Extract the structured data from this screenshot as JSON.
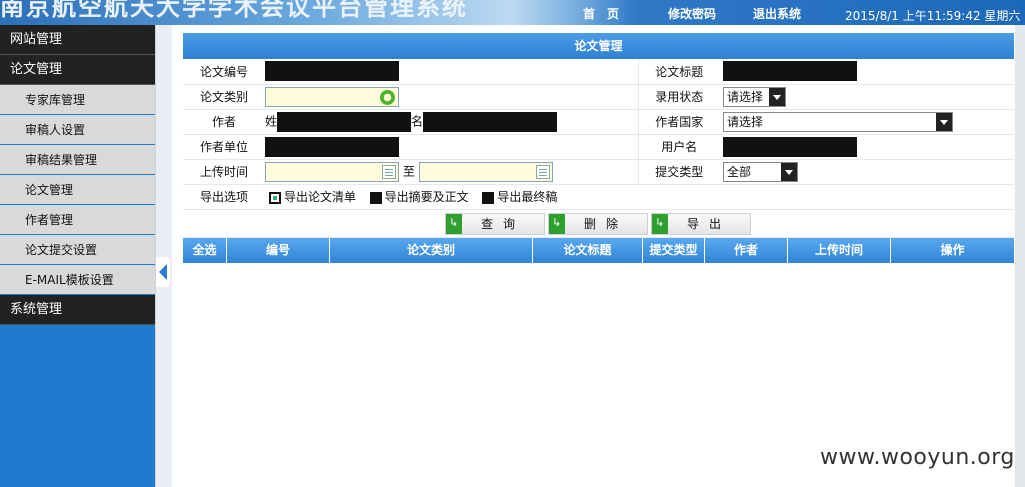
{
  "header": {
    "title": "南京航空航天大学学术会议平台管理系统",
    "nav": [
      "首　页",
      "修改密码",
      "退出系统"
    ],
    "clock": "2015/8/1 上午11:59:42 星期六"
  },
  "sidebar": {
    "items": [
      {
        "label": "网站管理",
        "level": 1
      },
      {
        "label": "论文管理",
        "level": 1
      },
      {
        "label": "专家库管理",
        "level": 2
      },
      {
        "label": "审稿人设置",
        "level": 2
      },
      {
        "label": "审稿结果管理",
        "level": 2
      },
      {
        "label": "论文管理",
        "level": 2
      },
      {
        "label": "作者管理",
        "level": 2
      },
      {
        "label": "论文提交设置",
        "level": 2
      },
      {
        "label": "E-MAIL模板设置",
        "level": 2
      },
      {
        "label": "系统管理",
        "level": 1
      }
    ]
  },
  "panel": {
    "title": "论文管理",
    "labels": {
      "paper_no": "论文编号",
      "paper_title": "论文标题",
      "paper_type": "论文类别",
      "accept_status": "录用状态",
      "author": "作者",
      "surname": "姓",
      "given_name": "名",
      "country": "作者国家",
      "affiliation": "作者单位",
      "username": "用户名",
      "upload_time": "上传时间",
      "to": "至",
      "submit_type": "提交类型",
      "export_options": "导出选项"
    },
    "selects": {
      "accept_status": "请选择",
      "country": "请选择",
      "submit_type": "全部"
    },
    "export_checks": [
      {
        "label": "导出论文清单",
        "checked": true
      },
      {
        "label": "导出摘要及正文",
        "checked": false
      },
      {
        "label": "导出最终稿",
        "checked": false
      }
    ],
    "buttons": {
      "query": "查询",
      "delete": "删除",
      "export": "导出"
    }
  },
  "grid": {
    "columns": [
      "全选",
      "编号",
      "论文类别",
      "论文标题",
      "提交类型",
      "作者",
      "上传时间",
      "操作"
    ]
  },
  "watermark": "www.wooyun.org"
}
